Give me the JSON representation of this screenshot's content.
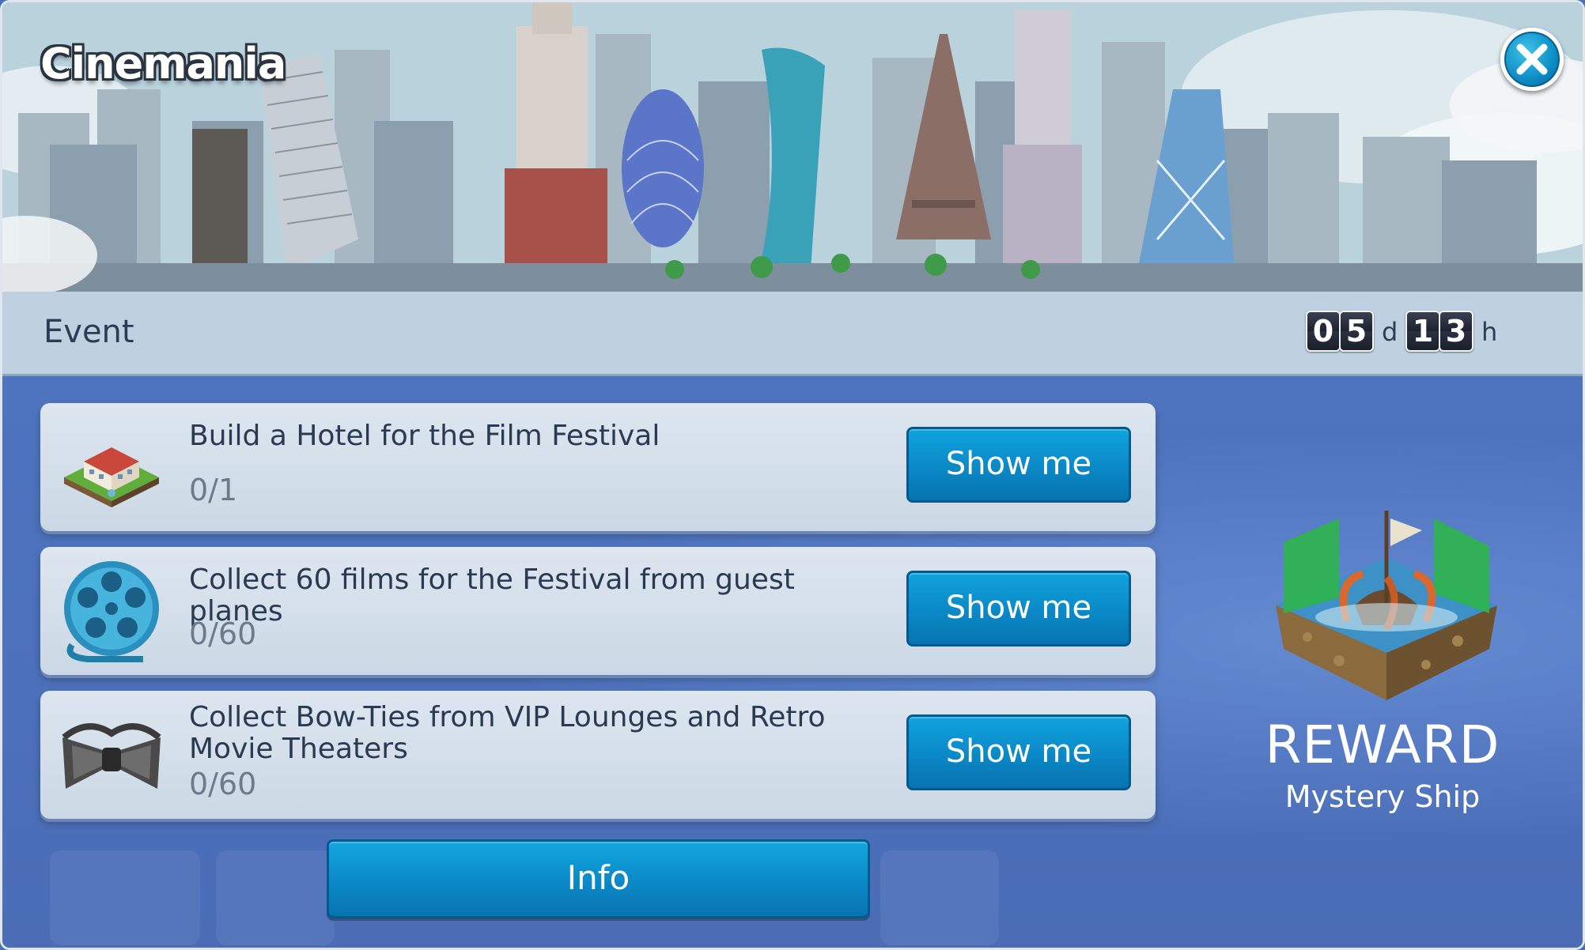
{
  "window": {
    "title": "Cinemania",
    "close_icon": "close-icon"
  },
  "event": {
    "label": "Event",
    "timer": {
      "days_digits": [
        "0",
        "5"
      ],
      "days_unit": "d",
      "hours_digits": [
        "1",
        "3"
      ],
      "hours_unit": "h"
    }
  },
  "tasks": [
    {
      "title": "Build a Hotel for the Film Festival",
      "progress": "0/1",
      "button": "Show me",
      "icon": "hotel-icon"
    },
    {
      "title": "Collect 60 films for the Festival from guest planes",
      "progress": "0/60",
      "button": "Show me",
      "icon": "film-reel-icon"
    },
    {
      "title": "Collect Bow-Ties from VIP Lounges and Retro Movie Theaters",
      "progress": "0/60",
      "button": "Show me",
      "icon": "bow-tie-icon"
    }
  ],
  "info_button": "Info",
  "reward": {
    "label": "REWARD",
    "name": "Mystery Ship",
    "icon": "mystery-ship-icon"
  },
  "colors": {
    "accent_button": "#0a86c4",
    "panel_bg": "#4a6fb8",
    "card_bg": "#d3dfea"
  }
}
